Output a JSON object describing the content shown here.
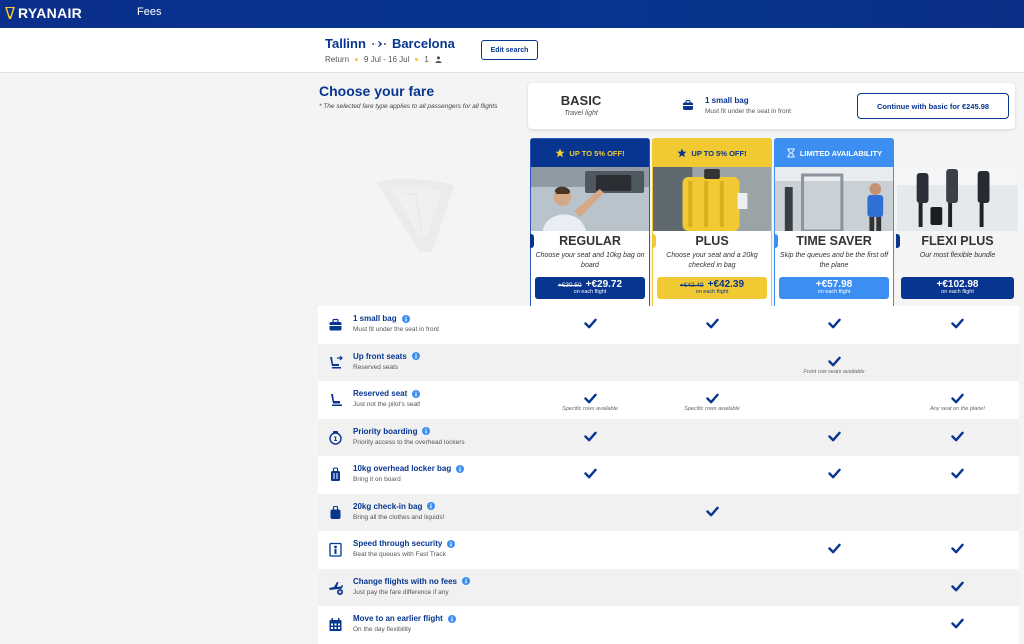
{
  "nav": {
    "brand": "RYANAIR",
    "fees_link": "Fees"
  },
  "trip": {
    "origin": "Tallinn",
    "destination": "Barcelona",
    "trip_type": "Return",
    "dates": "9 Jul - 16 Jul",
    "passengers": "1",
    "edit_label": "Edit search"
  },
  "intro": {
    "title": "Choose your fare",
    "note": "* The selected fare type applies to all passengers for all flights"
  },
  "basic": {
    "name": "BASIC",
    "tagline": "Travel light",
    "bag_title": "1 small bag",
    "bag_sub": "Must fit under the seat in front",
    "continue_label": "Continue with basic for €245.98"
  },
  "fares": [
    {
      "key": "regular",
      "banner": "UP TO 5% OFF!",
      "banner_icon": "star-icon",
      "name": "REGULAR",
      "desc": "Choose your seat and 10kg bag on board",
      "old_price": "+€30.50",
      "price": "+€29.72",
      "per": "on each flight",
      "color": "#073590"
    },
    {
      "key": "plus",
      "banner": "UP TO 5% OFF!",
      "banner_icon": "star-icon",
      "name": "PLUS",
      "desc": "Choose your seat and a 20kg checked in bag",
      "old_price": "+€43.49",
      "price": "+€42.39",
      "per": "on each flight",
      "color": "#f1c933"
    },
    {
      "key": "timesaver",
      "banner": "LIMITED AVAILABILITY",
      "banner_icon": "hourglass-icon",
      "name": "TIME SAVER",
      "desc": "Skip the queues and be the first off the plane",
      "old_price": "",
      "price": "+€57.98",
      "per": "on each flight",
      "color": "#3c8ef1"
    },
    {
      "key": "flexi",
      "banner": "",
      "banner_icon": "",
      "name": "FLEXI PLUS",
      "desc": "Our most flexible bundle",
      "old_price": "",
      "price": "+€102.98",
      "per": "on each flight",
      "color": "#073590"
    }
  ],
  "features": [
    {
      "icon": "small-bag-icon",
      "title": "1 small bag",
      "sub": "Must fit under the seat in front",
      "checks": [
        true,
        true,
        true,
        true
      ],
      "notes": [
        "",
        "",
        "",
        ""
      ]
    },
    {
      "icon": "up-front-seat-icon",
      "title": "Up front seats",
      "sub": "Reserved seats",
      "checks": [
        false,
        false,
        true,
        false
      ],
      "notes": [
        "",
        "",
        "Front row seats available",
        ""
      ]
    },
    {
      "icon": "reserved-seat-icon",
      "title": "Reserved seat",
      "sub": "Just not the pilot's seat!",
      "checks": [
        true,
        true,
        false,
        true
      ],
      "notes": [
        "Specific rows available",
        "Specific rows available",
        "",
        "Any seat on the plane!"
      ]
    },
    {
      "icon": "priority-boarding-icon",
      "title": "Priority boarding",
      "sub": "Priority access to the overhead lockers",
      "checks": [
        true,
        false,
        true,
        true
      ],
      "notes": [
        "",
        "",
        "",
        ""
      ]
    },
    {
      "icon": "locker-bag-icon",
      "title": "10kg overhead locker bag",
      "sub": "Bring it on board",
      "checks": [
        true,
        false,
        true,
        true
      ],
      "notes": [
        "",
        "",
        "",
        ""
      ]
    },
    {
      "icon": "checkin-bag-icon",
      "title": "20kg check-in bag",
      "sub": "Bring all the clothes and liquids!",
      "checks": [
        false,
        true,
        false,
        false
      ],
      "notes": [
        "",
        "",
        "",
        ""
      ]
    },
    {
      "icon": "fast-track-icon",
      "title": "Speed through security",
      "sub": "Beat the queues with Fast Track",
      "checks": [
        false,
        false,
        true,
        true
      ],
      "notes": [
        "",
        "",
        "",
        ""
      ]
    },
    {
      "icon": "change-flight-icon",
      "title": "Change flights with no fees",
      "sub": "Just pay the fare difference if any",
      "checks": [
        false,
        false,
        false,
        true
      ],
      "notes": [
        "",
        "",
        "",
        ""
      ]
    },
    {
      "icon": "calendar-icon",
      "title": "Move to an earlier flight",
      "sub": "On the day flexibility",
      "checks": [
        false,
        false,
        false,
        true
      ],
      "notes": [
        "",
        "",
        "",
        ""
      ]
    }
  ]
}
